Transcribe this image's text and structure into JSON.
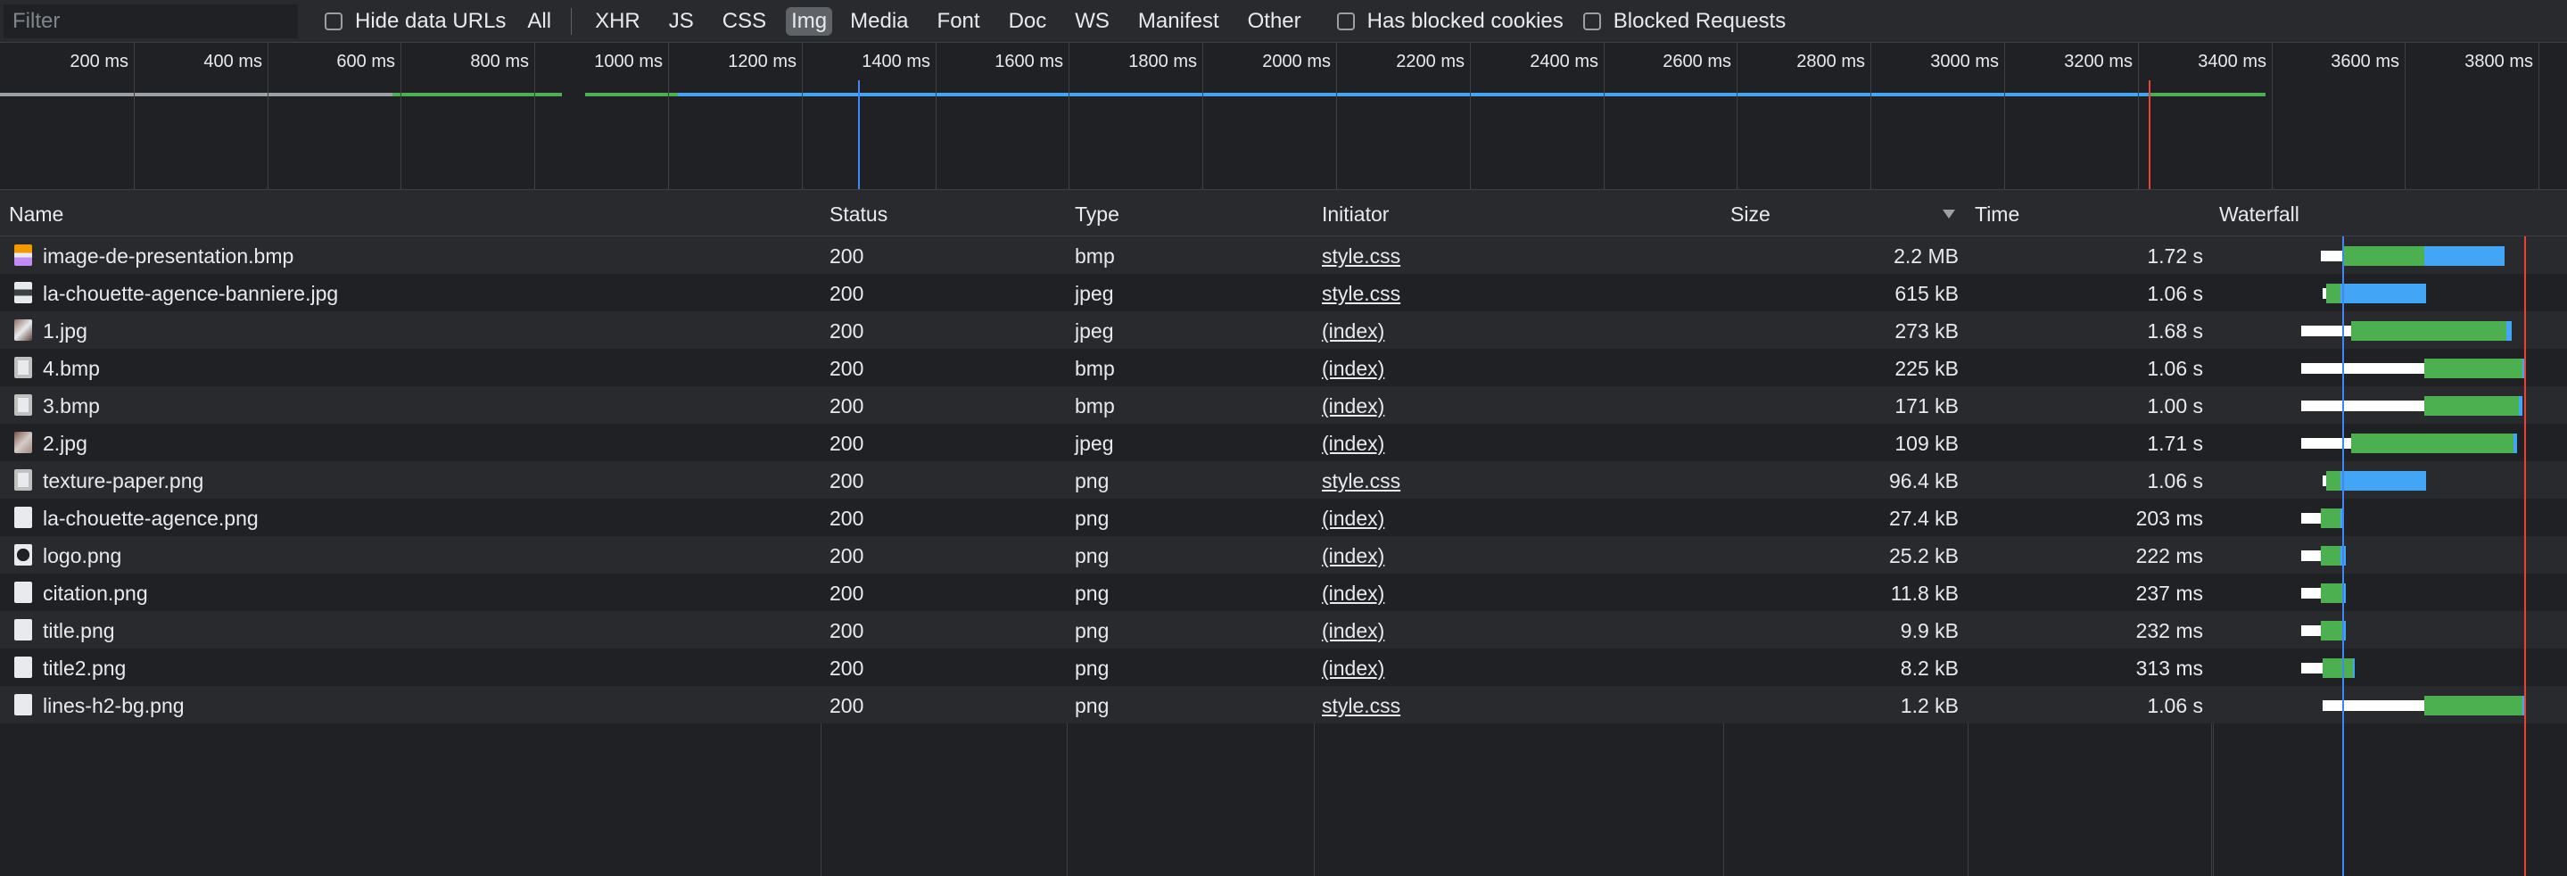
{
  "toolbar": {
    "filter_placeholder": "Filter",
    "hide_data_urls": "Hide data URLs",
    "types": [
      "All",
      "XHR",
      "JS",
      "CSS",
      "Img",
      "Media",
      "Font",
      "Doc",
      "WS",
      "Manifest",
      "Other"
    ],
    "active_type": "Img",
    "has_blocked_cookies": "Has blocked cookies",
    "blocked_requests": "Blocked Requests"
  },
  "overview": {
    "ticks": [
      "200 ms",
      "400 ms",
      "600 ms",
      "800 ms",
      "1000 ms",
      "1200 ms",
      "1400 ms",
      "1600 ms",
      "1800 ms",
      "2000 ms",
      "2200 ms",
      "2400 ms",
      "2600 ms",
      "2800 ms",
      "3000 ms",
      "3200 ms",
      "3400 ms",
      "3600 ms",
      "3800 ms"
    ]
  },
  "table": {
    "headers": {
      "name": "Name",
      "status": "Status",
      "type": "Type",
      "initiator": "Initiator",
      "size": "Size",
      "time": "Time",
      "waterfall": "Waterfall"
    },
    "sort_column": "Size",
    "sort_direction": "descending",
    "rows": [
      {
        "name": "image-de-presentation.bmp",
        "status": "200",
        "type": "bmp",
        "initiator": "style.css",
        "size": "2.2 MB",
        "time": "1.72 s"
      },
      {
        "name": "la-chouette-agence-banniere.jpg",
        "status": "200",
        "type": "jpeg",
        "initiator": "style.css",
        "size": "615 kB",
        "time": "1.06 s"
      },
      {
        "name": "1.jpg",
        "status": "200",
        "type": "jpeg",
        "initiator": "(index)",
        "size": "273 kB",
        "time": "1.68 s"
      },
      {
        "name": "4.bmp",
        "status": "200",
        "type": "bmp",
        "initiator": "(index)",
        "size": "225 kB",
        "time": "1.06 s"
      },
      {
        "name": "3.bmp",
        "status": "200",
        "type": "bmp",
        "initiator": "(index)",
        "size": "171 kB",
        "time": "1.00 s"
      },
      {
        "name": "2.jpg",
        "status": "200",
        "type": "jpeg",
        "initiator": "(index)",
        "size": "109 kB",
        "time": "1.71 s"
      },
      {
        "name": "texture-paper.png",
        "status": "200",
        "type": "png",
        "initiator": "style.css",
        "size": "96.4 kB",
        "time": "1.06 s"
      },
      {
        "name": "la-chouette-agence.png",
        "status": "200",
        "type": "png",
        "initiator": "(index)",
        "size": "27.4 kB",
        "time": "203 ms"
      },
      {
        "name": "logo.png",
        "status": "200",
        "type": "png",
        "initiator": "(index)",
        "size": "25.2 kB",
        "time": "222 ms"
      },
      {
        "name": "citation.png",
        "status": "200",
        "type": "png",
        "initiator": "(index)",
        "size": "11.8 kB",
        "time": "237 ms"
      },
      {
        "name": "title.png",
        "status": "200",
        "type": "png",
        "initiator": "(index)",
        "size": "9.9 kB",
        "time": "232 ms"
      },
      {
        "name": "title2.png",
        "status": "200",
        "type": "png",
        "initiator": "(index)",
        "size": "8.2 kB",
        "time": "313 ms"
      },
      {
        "name": "lines-h2-bg.png",
        "status": "200",
        "type": "png",
        "initiator": "style.css",
        "size": "1.2 kB",
        "time": "1.06 s"
      }
    ]
  },
  "colors": {
    "waiting": "#ffffff",
    "ttfb": "#4caf50",
    "download": "#42a5f5",
    "dom_content_loaded": "#4285f4",
    "load": "#ea4335"
  }
}
